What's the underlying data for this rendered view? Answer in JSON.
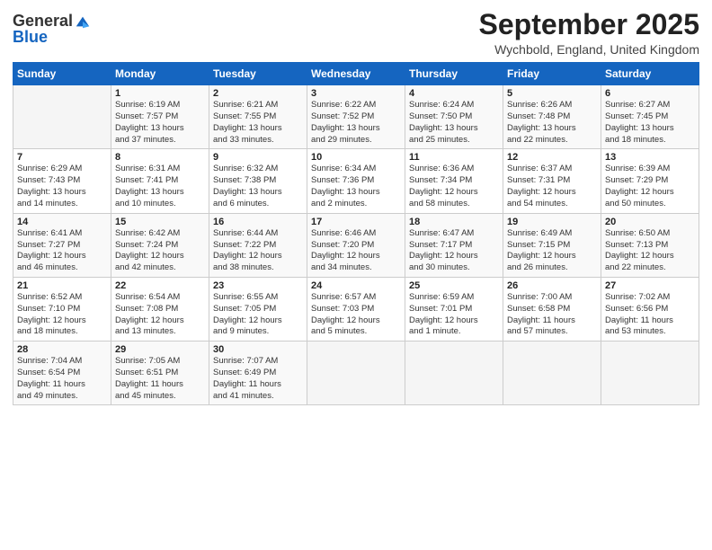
{
  "header": {
    "logo_general": "General",
    "logo_blue": "Blue",
    "month_title": "September 2025",
    "location": "Wychbold, England, United Kingdom"
  },
  "days_of_week": [
    "Sunday",
    "Monday",
    "Tuesday",
    "Wednesday",
    "Thursday",
    "Friday",
    "Saturday"
  ],
  "weeks": [
    [
      {
        "day": "",
        "info": ""
      },
      {
        "day": "1",
        "info": "Sunrise: 6:19 AM\nSunset: 7:57 PM\nDaylight: 13 hours\nand 37 minutes."
      },
      {
        "day": "2",
        "info": "Sunrise: 6:21 AM\nSunset: 7:55 PM\nDaylight: 13 hours\nand 33 minutes."
      },
      {
        "day": "3",
        "info": "Sunrise: 6:22 AM\nSunset: 7:52 PM\nDaylight: 13 hours\nand 29 minutes."
      },
      {
        "day": "4",
        "info": "Sunrise: 6:24 AM\nSunset: 7:50 PM\nDaylight: 13 hours\nand 25 minutes."
      },
      {
        "day": "5",
        "info": "Sunrise: 6:26 AM\nSunset: 7:48 PM\nDaylight: 13 hours\nand 22 minutes."
      },
      {
        "day": "6",
        "info": "Sunrise: 6:27 AM\nSunset: 7:45 PM\nDaylight: 13 hours\nand 18 minutes."
      }
    ],
    [
      {
        "day": "7",
        "info": "Sunrise: 6:29 AM\nSunset: 7:43 PM\nDaylight: 13 hours\nand 14 minutes."
      },
      {
        "day": "8",
        "info": "Sunrise: 6:31 AM\nSunset: 7:41 PM\nDaylight: 13 hours\nand 10 minutes."
      },
      {
        "day": "9",
        "info": "Sunrise: 6:32 AM\nSunset: 7:38 PM\nDaylight: 13 hours\nand 6 minutes."
      },
      {
        "day": "10",
        "info": "Sunrise: 6:34 AM\nSunset: 7:36 PM\nDaylight: 13 hours\nand 2 minutes."
      },
      {
        "day": "11",
        "info": "Sunrise: 6:36 AM\nSunset: 7:34 PM\nDaylight: 12 hours\nand 58 minutes."
      },
      {
        "day": "12",
        "info": "Sunrise: 6:37 AM\nSunset: 7:31 PM\nDaylight: 12 hours\nand 54 minutes."
      },
      {
        "day": "13",
        "info": "Sunrise: 6:39 AM\nSunset: 7:29 PM\nDaylight: 12 hours\nand 50 minutes."
      }
    ],
    [
      {
        "day": "14",
        "info": "Sunrise: 6:41 AM\nSunset: 7:27 PM\nDaylight: 12 hours\nand 46 minutes."
      },
      {
        "day": "15",
        "info": "Sunrise: 6:42 AM\nSunset: 7:24 PM\nDaylight: 12 hours\nand 42 minutes."
      },
      {
        "day": "16",
        "info": "Sunrise: 6:44 AM\nSunset: 7:22 PM\nDaylight: 12 hours\nand 38 minutes."
      },
      {
        "day": "17",
        "info": "Sunrise: 6:46 AM\nSunset: 7:20 PM\nDaylight: 12 hours\nand 34 minutes."
      },
      {
        "day": "18",
        "info": "Sunrise: 6:47 AM\nSunset: 7:17 PM\nDaylight: 12 hours\nand 30 minutes."
      },
      {
        "day": "19",
        "info": "Sunrise: 6:49 AM\nSunset: 7:15 PM\nDaylight: 12 hours\nand 26 minutes."
      },
      {
        "day": "20",
        "info": "Sunrise: 6:50 AM\nSunset: 7:13 PM\nDaylight: 12 hours\nand 22 minutes."
      }
    ],
    [
      {
        "day": "21",
        "info": "Sunrise: 6:52 AM\nSunset: 7:10 PM\nDaylight: 12 hours\nand 18 minutes."
      },
      {
        "day": "22",
        "info": "Sunrise: 6:54 AM\nSunset: 7:08 PM\nDaylight: 12 hours\nand 13 minutes."
      },
      {
        "day": "23",
        "info": "Sunrise: 6:55 AM\nSunset: 7:05 PM\nDaylight: 12 hours\nand 9 minutes."
      },
      {
        "day": "24",
        "info": "Sunrise: 6:57 AM\nSunset: 7:03 PM\nDaylight: 12 hours\nand 5 minutes."
      },
      {
        "day": "25",
        "info": "Sunrise: 6:59 AM\nSunset: 7:01 PM\nDaylight: 12 hours\nand 1 minute."
      },
      {
        "day": "26",
        "info": "Sunrise: 7:00 AM\nSunset: 6:58 PM\nDaylight: 11 hours\nand 57 minutes."
      },
      {
        "day": "27",
        "info": "Sunrise: 7:02 AM\nSunset: 6:56 PM\nDaylight: 11 hours\nand 53 minutes."
      }
    ],
    [
      {
        "day": "28",
        "info": "Sunrise: 7:04 AM\nSunset: 6:54 PM\nDaylight: 11 hours\nand 49 minutes."
      },
      {
        "day": "29",
        "info": "Sunrise: 7:05 AM\nSunset: 6:51 PM\nDaylight: 11 hours\nand 45 minutes."
      },
      {
        "day": "30",
        "info": "Sunrise: 7:07 AM\nSunset: 6:49 PM\nDaylight: 11 hours\nand 41 minutes."
      },
      {
        "day": "",
        "info": ""
      },
      {
        "day": "",
        "info": ""
      },
      {
        "day": "",
        "info": ""
      },
      {
        "day": "",
        "info": ""
      }
    ]
  ]
}
